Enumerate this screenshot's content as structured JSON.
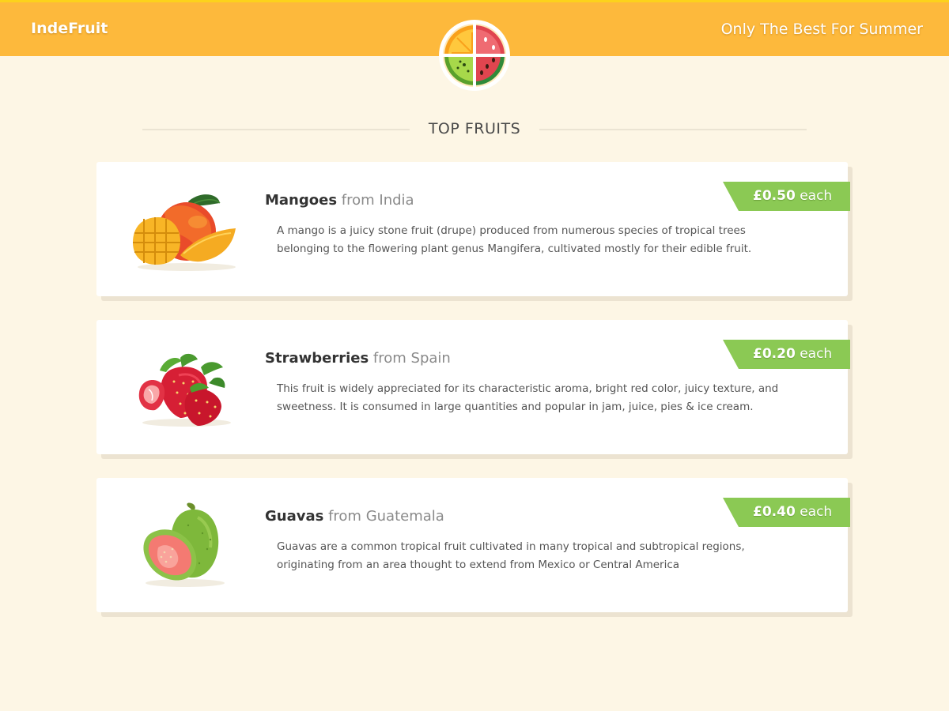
{
  "header": {
    "brand": "IndeFruit",
    "tagline": "Only The Best For Summer",
    "logo_icon": "fruit-slices-logo-icon"
  },
  "section": {
    "title": "TOP FRUITS"
  },
  "products": [
    {
      "name": "Mangoes",
      "origin": "from India",
      "description": "A mango is a juicy stone fruit (drupe) produced from numerous species of tropical trees belonging to the flowering plant genus Mangifera, cultivated mostly for their edible fruit.",
      "price": "£0.50",
      "unit": "each",
      "image_icon": "mango-icon"
    },
    {
      "name": "Strawberries",
      "origin": "from Spain",
      "description": "This fruit is widely appreciated for its characteristic aroma, bright red color, juicy texture, and sweetness. It is consumed in large quantities and popular in jam, juice, pies & ice cream.",
      "price": "£0.20",
      "unit": "each",
      "image_icon": "strawberry-icon"
    },
    {
      "name": "Guavas",
      "origin": "from Guatemala",
      "description": "Guavas are a common tropical fruit cultivated in many tropical and subtropical regions, originating from an area thought to extend from Mexico or Central America",
      "price": "£0.40",
      "unit": "each",
      "image_icon": "guava-icon"
    }
  ],
  "colors": {
    "header_bg": "#fdb93c",
    "page_bg": "#fdf6e5",
    "price_tag": "#8bc954"
  }
}
